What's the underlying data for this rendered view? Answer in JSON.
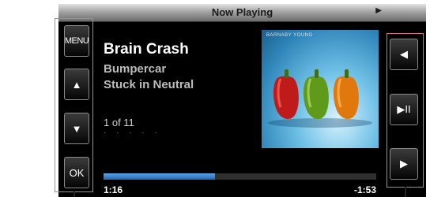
{
  "header": {
    "title": "Now Playing",
    "play_indicator": "▶"
  },
  "left_controls": {
    "menu": "MENU",
    "up": "▲",
    "down": "▼",
    "ok": "OK"
  },
  "right_controls": {
    "previous": "◀",
    "play_pause": "▶II",
    "next": "▶"
  },
  "track": {
    "title": "Brain Crash",
    "artist": "Bumpercar",
    "album": "Stuck in Neutral",
    "position": "1 of 11",
    "dots": "· · · · ·"
  },
  "album_art": {
    "label": "BARNABY YOUNG"
  },
  "playback": {
    "elapsed": "1:16",
    "remaining": "-1:53",
    "progress": 0.41
  },
  "colors": {
    "accent": "#3d86d8",
    "callout": "#d87090",
    "screen_bg": "#000000"
  }
}
